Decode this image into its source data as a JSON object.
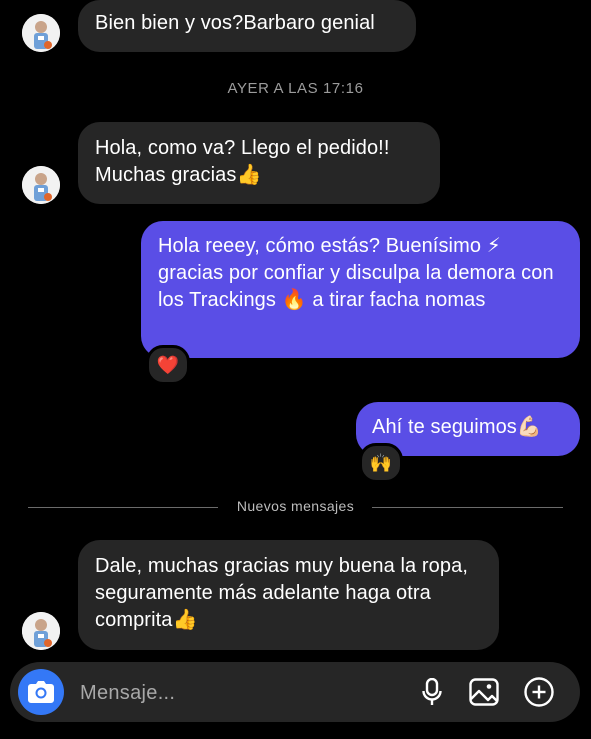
{
  "thread": {
    "messages": [
      {
        "direction": "incoming",
        "text": "Bien bien y vos?Barbaro genial"
      },
      {
        "direction": "incoming",
        "text": "Hola, como va? Llego el pedido!! Muchas gracias👍"
      },
      {
        "direction": "outgoing",
        "text": "Hola reeey, cómo estás? Buenísimo ⚡ gracias por confiar y disculpa la demora con los Trackings 🔥  a tirar facha nomas",
        "reaction": "❤️"
      },
      {
        "direction": "outgoing",
        "text": "Ahí te seguimos💪🏻",
        "reaction": "🙌"
      },
      {
        "direction": "incoming",
        "text": "Dale, muchas gracias muy buena la ropa, seguramente más adelante haga otra comprita👍"
      }
    ],
    "timestamp": "AYER A LAS 17:16",
    "new_messages_divider": "Nuevos mensajes"
  },
  "composer": {
    "placeholder": "Mensaje...",
    "icons": [
      "camera-icon",
      "microphone-icon",
      "gallery-icon",
      "plus-icon"
    ]
  },
  "colors": {
    "background": "#000000",
    "incoming_bubble": "#262626",
    "outgoing_bubble": "#5a4ee6",
    "camera_button": "#3478f6"
  }
}
